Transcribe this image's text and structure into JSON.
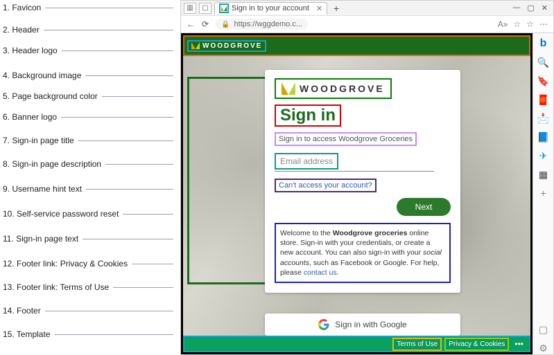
{
  "browser": {
    "tab_title": "Sign in to your account",
    "url": "https://wggdemo.c...",
    "nav": {
      "back": "←",
      "refresh": "⟳",
      "lock": "🔒"
    },
    "toolbar": {
      "read": "A»",
      "person": "☆",
      "star": "☆",
      "more": "⋯"
    },
    "win": {
      "min": "—",
      "max": "▢",
      "close": "✕"
    }
  },
  "edge_sidebar": {
    "bing": "b",
    "items": [
      "🔍",
      "🔖",
      "🧧",
      "📩",
      "📘",
      "✈",
      "▦"
    ],
    "plus": "+",
    "bottom": [
      "▢",
      "⚙"
    ]
  },
  "page": {
    "header_logo_text": "WOODGROVE",
    "banner_logo_text": "WOODGROVE",
    "title": "Sign in",
    "description": "Sign in to access Woodgrove Groceries",
    "email_placeholder": "Email address",
    "sspr": "Can't access your account?",
    "next": "Next",
    "text_prefix": "Welcome to the ",
    "text_bold1": "Woodgrove groceries",
    "text_mid1": " online store. Sign-in with your credentials, or create a new account. You can also sign-in with your ",
    "text_italic": "social accounts",
    "text_mid2": ", such as Facebook or Google. For help, please ",
    "text_link": "contact us",
    "text_end": ".",
    "google": "Sign in with Google",
    "footer": {
      "terms": "Terms of Use",
      "privacy": "Privacy & Cookies",
      "more": "•••"
    }
  },
  "annotations": [
    "1. Favicon",
    "2. Header",
    "3. Header logo",
    "4. Background image",
    "5. Page background  color",
    "6. Banner logo",
    "7. Sign-in page title",
    "8. Sign-in page description",
    "9. Username hint text",
    "10. Self-service password reset",
    "11. Sign-in page text",
    "12. Footer link: Privacy & Cookies",
    "13. Footer link: Terms of Use",
    "14. Footer",
    "15. Template"
  ]
}
